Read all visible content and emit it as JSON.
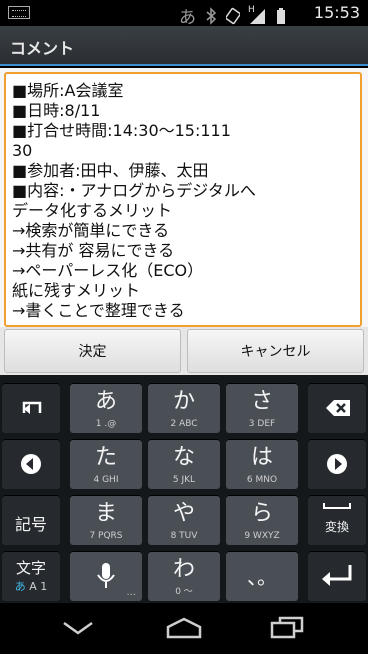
{
  "status_bar": {
    "ime_indicator": "あ",
    "signal_type": "H",
    "time": "15:53",
    "icons": [
      "keyboard-icon",
      "bluetooth-icon",
      "rotate-icon",
      "signal-icon",
      "battery-icon"
    ]
  },
  "title_bar": {
    "title": "コメント",
    "accent_color": "#3b8fd0"
  },
  "editor": {
    "lines": [
      "■場所:A会議室",
      "■日時:8/11",
      "■打合せ時間:14:30〜15:111",
      "30",
      "■参加者:田中、伊藤、太田",
      "■内容:・アナログからデジタルへ",
      "データ化するメリット",
      "→検索が簡単にできる",
      "→共有が 容易にできる",
      "→ペーパーレス化（ECO）",
      "紙に残すメリット",
      "→書くことで整理できる"
    ],
    "border_color": "#f0a030"
  },
  "buttons": {
    "ok": "決定",
    "cancel": "キャンセル"
  },
  "keyboard": {
    "keys": [
      {
        "main": "あ",
        "sub": "1 .@"
      },
      {
        "main": "か",
        "sub": "2 ABC"
      },
      {
        "main": "さ",
        "sub": "3 DEF"
      },
      {
        "main": "た",
        "sub": "4 GHI"
      },
      {
        "main": "な",
        "sub": "5 JKL"
      },
      {
        "main": "は",
        "sub": "6 MNO"
      },
      {
        "main": "ま",
        "sub": "7 PQRS"
      },
      {
        "main": "や",
        "sub": "8 TUV"
      },
      {
        "main": "ら",
        "sub": "9 WXYZ"
      },
      {
        "main": "わ",
        "sub": "0 〜"
      },
      {
        "main": "、。",
        "sub": ""
      }
    ],
    "kigou": "記号",
    "henkan": "変換",
    "moji_main": "文字",
    "moji_sub_hira": "あ",
    "moji_sub_rest": "A 1",
    "mic_corner": "..."
  }
}
